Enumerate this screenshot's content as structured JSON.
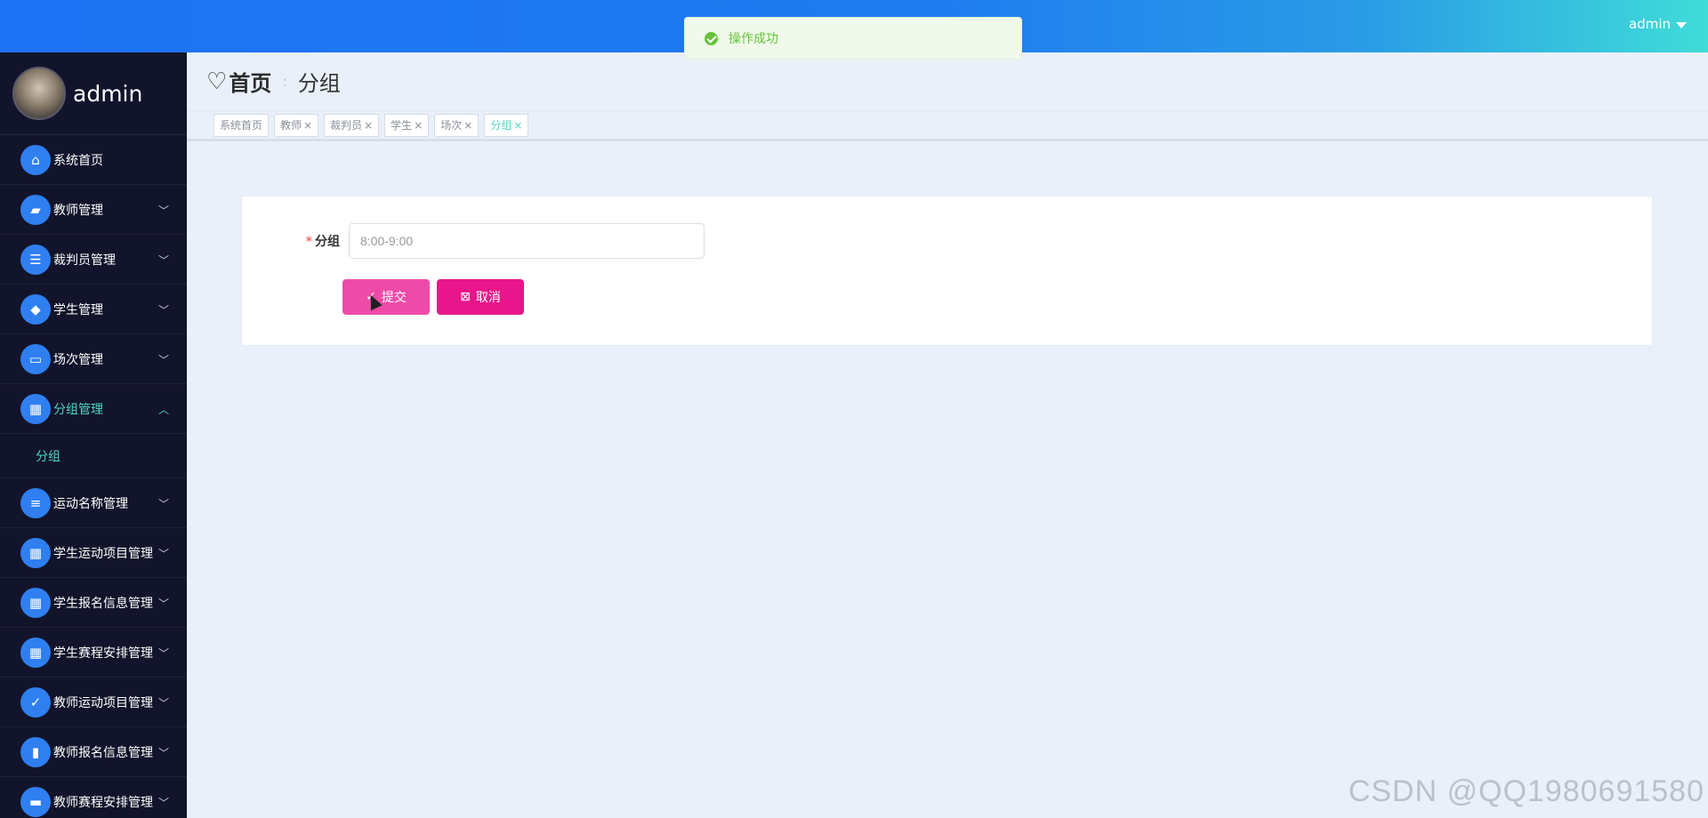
{
  "topbar": {
    "user": "admin"
  },
  "toast": {
    "message": "操作成功"
  },
  "sidebar": {
    "profile_name": "admin",
    "items": [
      {
        "label": "系统首页",
        "icon": "home-icon",
        "glyph": "⌂",
        "expandable": false
      },
      {
        "label": "教师管理",
        "icon": "briefcase-icon",
        "glyph": "▰",
        "expandable": true
      },
      {
        "label": "裁判员管理",
        "icon": "sliders-icon",
        "glyph": "☰",
        "expandable": true
      },
      {
        "label": "学生管理",
        "icon": "user-card-icon",
        "glyph": "◆",
        "expandable": true
      },
      {
        "label": "场次管理",
        "icon": "screen-icon",
        "glyph": "▭",
        "expandable": true
      },
      {
        "label": "分组管理",
        "icon": "grid-icon",
        "glyph": "▦",
        "expandable": true,
        "active": true
      },
      {
        "label": "运动名称管理",
        "icon": "list-icon",
        "glyph": "≡",
        "expandable": true
      },
      {
        "label": "学生运动项目管理",
        "icon": "grid-icon",
        "glyph": "▦",
        "expandable": true
      },
      {
        "label": "学生报名信息管理",
        "icon": "grid-icon",
        "glyph": "▦",
        "expandable": true
      },
      {
        "label": "学生赛程安排管理",
        "icon": "grid-icon",
        "glyph": "▦",
        "expandable": true
      },
      {
        "label": "教师运动项目管理",
        "icon": "clipboard-icon",
        "glyph": "✓",
        "expandable": true
      },
      {
        "label": "教师报名信息管理",
        "icon": "book-icon",
        "glyph": "▮",
        "expandable": true
      },
      {
        "label": "教师赛程安排管理",
        "icon": "ticket-icon",
        "glyph": "▬",
        "expandable": true
      }
    ],
    "submenu": {
      "label": "分组"
    }
  },
  "breadcrumb": {
    "home": "首页",
    "current": "分组"
  },
  "tags": [
    {
      "label": "系统首页",
      "closable": false
    },
    {
      "label": "教师",
      "closable": true
    },
    {
      "label": "裁判员",
      "closable": true
    },
    {
      "label": "学生",
      "closable": true
    },
    {
      "label": "场次",
      "closable": true
    },
    {
      "label": "分组",
      "closable": true,
      "active": true
    }
  ],
  "form": {
    "label": "分组",
    "value": "8:00-9:00",
    "submit_label": "提交",
    "cancel_label": "取消"
  },
  "watermark": "CSDN @QQ1980691580"
}
